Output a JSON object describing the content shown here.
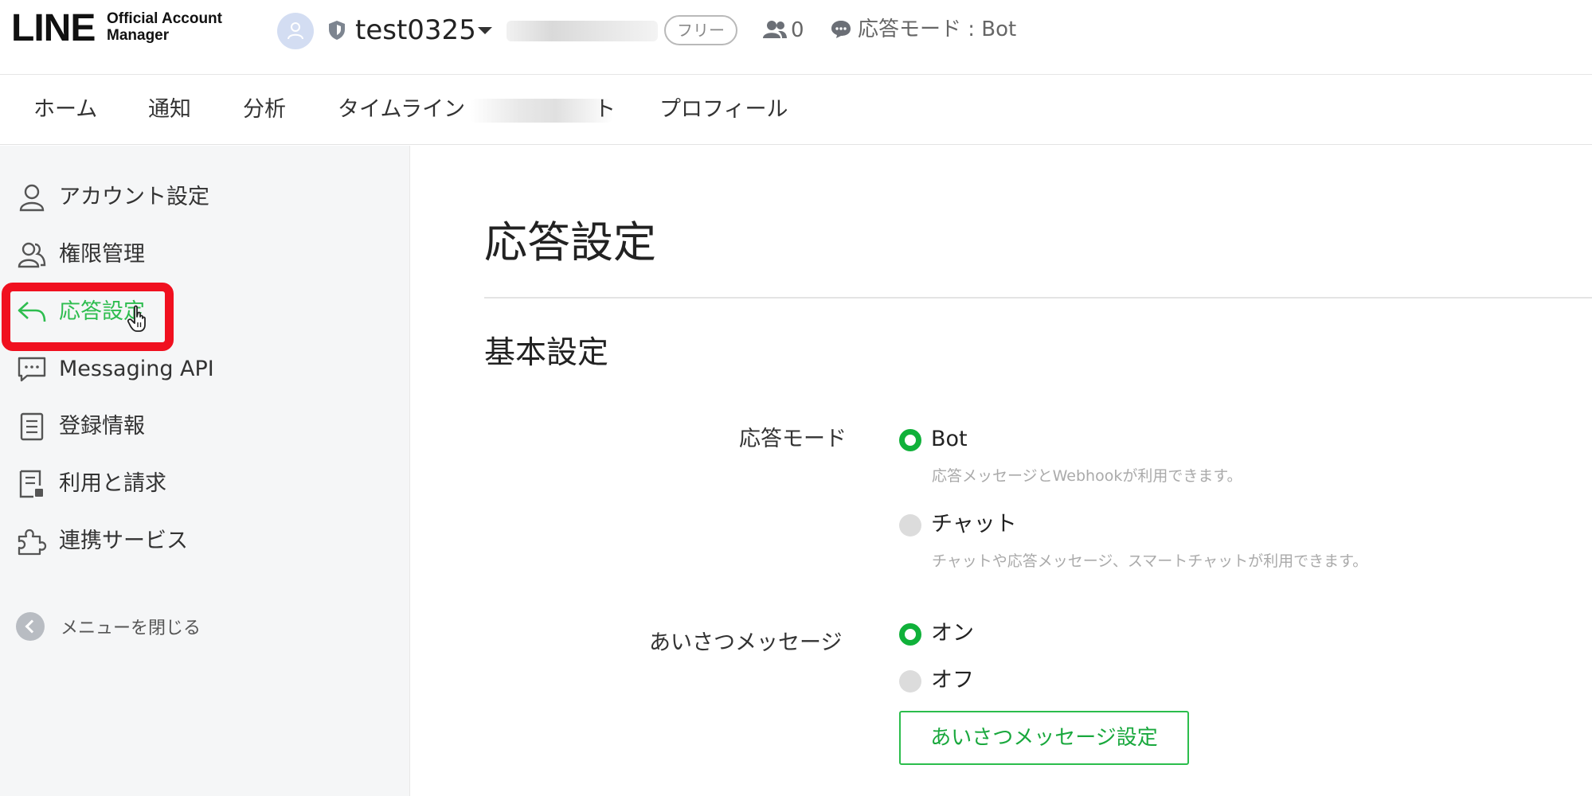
{
  "header": {
    "logo_main": "LINE",
    "logo_sub_1": "Official Account",
    "logo_sub_2": "Manager",
    "account_name": "test0325",
    "plan_badge": "フリー",
    "friend_count": "0",
    "response_mode": "応答モード : Bot"
  },
  "nav": {
    "items": [
      "ホーム",
      "通知",
      "分析",
      "タイムライン",
      "ト",
      "プロフィール"
    ]
  },
  "sidebar": {
    "items": [
      {
        "label": "アカウント設定",
        "icon": "person-icon"
      },
      {
        "label": "権限管理",
        "icon": "users-icon"
      },
      {
        "label": "応答設定",
        "icon": "reply-icon"
      },
      {
        "label": "Messaging API",
        "icon": "chat-dots-icon"
      },
      {
        "label": "登録情報",
        "icon": "document-icon"
      },
      {
        "label": "利用と請求",
        "icon": "bill-icon"
      },
      {
        "label": "連携サービス",
        "icon": "puzzle-icon"
      }
    ],
    "collapse_label": "メニューを閉じる"
  },
  "main": {
    "page_title": "応答設定",
    "section_title": "基本設定",
    "response_mode": {
      "label": "応答モード",
      "options": [
        {
          "label": "Bot",
          "hint": "応答メッセージとWebhookが利用できます。",
          "selected": true
        },
        {
          "label": "チャット",
          "hint": "チャットや応答メッセージ、スマートチャットが利用できます。",
          "selected": false
        }
      ]
    },
    "greeting": {
      "label": "あいさつメッセージ",
      "options": [
        {
          "label": "オン",
          "selected": true
        },
        {
          "label": "オフ",
          "selected": false
        }
      ],
      "button": "あいさつメッセージ設定"
    }
  },
  "colors": {
    "accent_green": "#2ebd4f",
    "highlight_red": "#f0101f"
  }
}
